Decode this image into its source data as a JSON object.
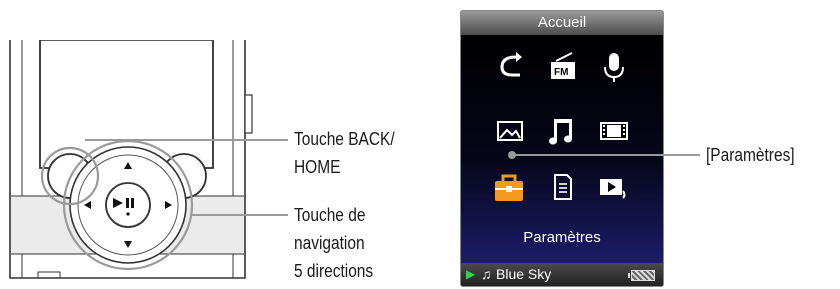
{
  "callouts": {
    "back_home_line1": "Touche BACK/",
    "back_home_line2": "HOME",
    "nav_line1": "Touche de",
    "nav_line2": "navigation",
    "nav_line3": "5 directions",
    "params": "[Paramètres]"
  },
  "screen": {
    "title": "Accueil",
    "selected_label": "Paramètres",
    "now_playing": "Blue Sky",
    "icons": [
      "repeat-icon",
      "fm-radio-icon",
      "microphone-icon",
      "photo-icon",
      "music-note-icon",
      "video-film-icon",
      "toolbox-settings-icon",
      "document-icon",
      "slideshow-icon"
    ]
  },
  "colors": {
    "selected_icon": "#f39a1e",
    "play_indicator": "#2fd24a",
    "screen_bg": "#000000",
    "menu_gradient_bottom": "#1c1c6a"
  }
}
